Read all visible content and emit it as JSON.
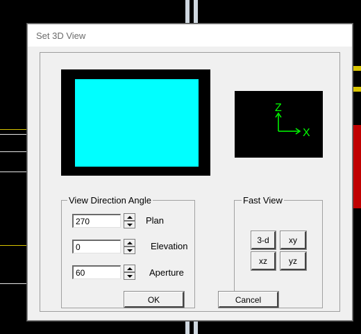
{
  "dialog": {
    "title": "Set 3D View",
    "preview": {
      "fill_color": "#00ffff"
    },
    "axes": {
      "z_label": "Z",
      "x_label": "X",
      "color": "#00ff00"
    },
    "view_direction": {
      "legend": "View Direction Angle",
      "plan": {
        "value": "270",
        "label": "Plan"
      },
      "elevation": {
        "value": "0",
        "label": "Elevation"
      },
      "aperture": {
        "value": "60",
        "label": "Aperture"
      }
    },
    "fast_view": {
      "legend": "Fast View",
      "buttons": [
        "3-d",
        "xy",
        "xz",
        "yz"
      ]
    },
    "ok_label": "OK",
    "cancel_label": "Cancel"
  }
}
